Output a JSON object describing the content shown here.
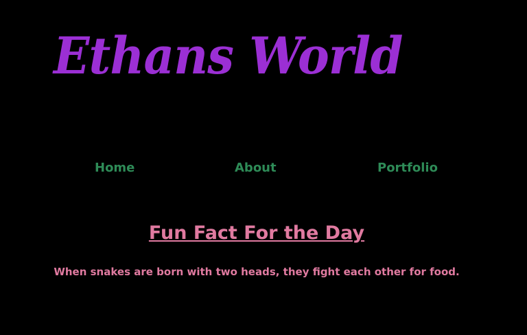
{
  "colors": {
    "background": "#000000",
    "title": "#9b2fd4",
    "nav_link": "#2e8b57",
    "fact": "#e07aa0"
  },
  "header": {
    "title": "Ethans World"
  },
  "nav": {
    "items": [
      {
        "label": "Home"
      },
      {
        "label": "About"
      },
      {
        "label": "Portfolio"
      }
    ]
  },
  "fun_fact": {
    "heading": "Fun Fact For the Day",
    "text": "When snakes are born with two heads, they fight each other for food."
  }
}
